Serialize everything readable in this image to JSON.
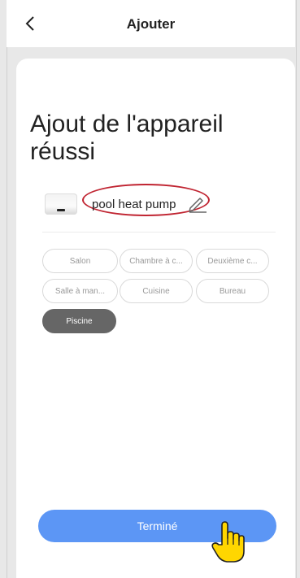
{
  "header": {
    "title": "Ajouter",
    "back_icon": "chevron-left-icon"
  },
  "main": {
    "headline": "Ajout de l'appareil réussi",
    "device": {
      "name": "pool heat pump",
      "edit_icon": "pencil-icon"
    },
    "rooms": [
      {
        "label": "Salon",
        "selected": false
      },
      {
        "label": "Chambre à c...",
        "selected": false
      },
      {
        "label": "Deuxième c...",
        "selected": false
      },
      {
        "label": "Salle à man...",
        "selected": false
      },
      {
        "label": "Cuisine",
        "selected": false
      },
      {
        "label": "Bureau",
        "selected": false
      },
      {
        "label": "Piscine",
        "selected": true
      }
    ],
    "done_label": "Terminé"
  },
  "colors": {
    "accent": "#5c96f5",
    "highlight_oval": "#c02431",
    "chip_selected": "#666666",
    "cursor_fill": "#ffd600"
  }
}
